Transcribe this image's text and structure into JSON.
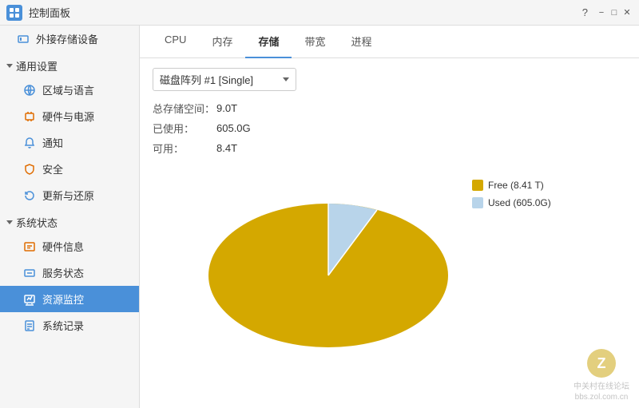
{
  "titlebar": {
    "title": "控制面板",
    "question_btn": "?",
    "minimize_btn": "−",
    "maximize_btn": "□",
    "close_btn": "✕"
  },
  "sidebar": {
    "external_storage": "外接存储设备",
    "general_settings": "通用设置",
    "region_language": "区域与语言",
    "hardware_power": "硬件与电源",
    "notification": "通知",
    "security": "安全",
    "update_restore": "更新与还原",
    "system_status": "系统状态",
    "hardware_info": "硬件信息",
    "service_status": "服务状态",
    "resource_monitor": "资源监控",
    "system_log": "系统记录"
  },
  "tabs": {
    "cpu": "CPU",
    "memory": "内存",
    "storage": "存储",
    "bandwidth": "带宽",
    "process": "进程"
  },
  "storage": {
    "dropdown_label": "磁盘阵列 #1 [Single]",
    "total_label": "总存储空间：",
    "total_value": "9.0T",
    "used_label": "已使用：",
    "used_value": "605.0G",
    "available_label": "可用：",
    "available_value": "8.4T",
    "legend_free": "Free (8.41 T)",
    "legend_used": "Used (605.0G)",
    "free_color": "#D4A800",
    "used_color": "#B8D4EA"
  },
  "pie": {
    "total_degrees": 360,
    "used_percent": 6.6,
    "free_percent": 93.4
  },
  "watermark": {
    "symbol": "Z",
    "line1": "中关村在线论坛",
    "line2": "bbs.zol.com.cn"
  }
}
